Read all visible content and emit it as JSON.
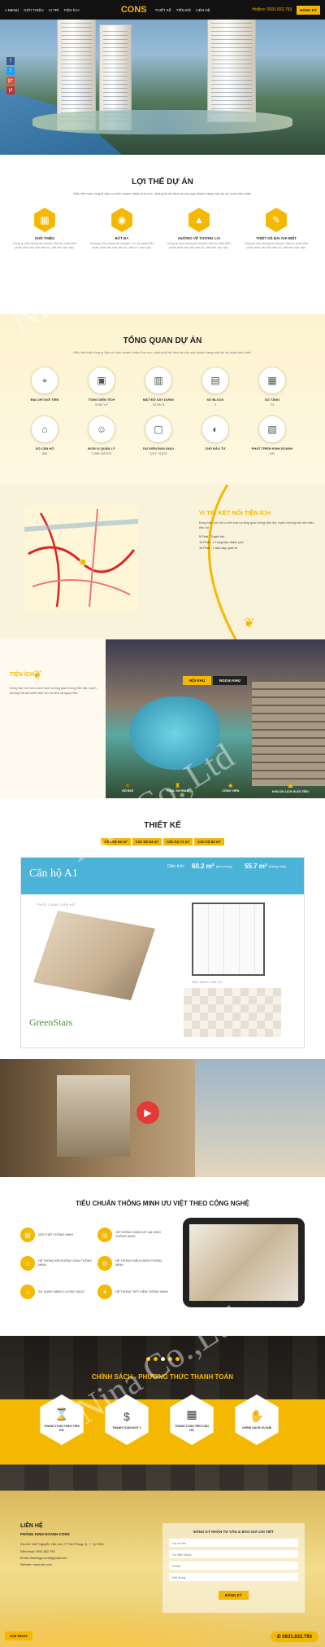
{
  "header": {
    "menu_label": "≡ MENU",
    "nav": [
      "GIỚI THIỆU",
      "VỊ TRÍ",
      "TIỆN ÍCH",
      "THIẾT KẾ",
      "TIẾN ĐỘ",
      "LIÊN HỆ"
    ],
    "logo": "CONS",
    "phone": "Hotline: 0931.832.793",
    "cta": "ĐĂNG KÝ"
  },
  "hero": {
    "social": [
      "f",
      "t",
      "g+",
      "yt"
    ]
  },
  "overview": {
    "title": "LỢI THẾ DỰ ÁN",
    "subtitle": "Hiểu thế mới công ty đầu cơ kinh doanh nhiều lĩnh vực, chúng tôi sẽ đem lại cho quý khách hàng một dự án hoàn hảo nhất.",
    "features": [
      {
        "title": "GIỚI THIỆU",
        "desc": "Công ty của chúng tôi chuyên đầu tư phát triển phân phối các loại căn hộ, đất nền cao cấp.",
        "icon": "building-icon"
      },
      {
        "title": "BẤT ĐÁ",
        "desc": "Công ty của chúng tôi chuyên đầu tư phát triển phân phối các loại căn hộ, đất nền cao cấp.",
        "icon": "location-icon"
      },
      {
        "title": "HƯỚNG VỀ TƯƠNG LAI",
        "desc": "Công ty của chúng tôi chuyên đầu tư phát triển phân phối các loại căn hộ, đất nền cao cấp.",
        "icon": "chart-icon"
      },
      {
        "title": "THIẾT KẾ ĐẠI CHI BIỆT",
        "desc": "Công ty của chúng tôi chuyên đầu tư phát triển phân phối các loại căn hộ, đất nền cao cấp.",
        "icon": "design-icon"
      }
    ]
  },
  "stats": {
    "title": "TỔNG QUAN DỰ ÁN",
    "subtitle": "Hiểu thế mới công ty đầu cơ kinh doanh nhiều lĩnh vực, chúng tôi sẽ đem lại cho quý khách hàng một dự án hoàn hảo nhất.",
    "items": [
      {
        "label": "ĐỊA CHỈ GIỚI TIẾN",
        "value": "",
        "icon": "pin-icon"
      },
      {
        "label": "TỔNG DIỆN TÍCH",
        "value": "9.987 m²",
        "icon": "area-icon"
      },
      {
        "label": "MẬT ĐỘ XÂY DỰNG",
        "value": "34.88 %",
        "icon": "density-icon"
      },
      {
        "label": "SỐ BLOCK",
        "value": "2",
        "icon": "block-icon"
      },
      {
        "label": "SỐ TẦNG",
        "value": "24",
        "icon": "floor-icon"
      },
      {
        "label": "SỐ CĂN HỘ",
        "value": "966",
        "icon": "apartment-icon"
      },
      {
        "label": "ĐƠN VỊ QUẢN LÝ",
        "value": "2.288 NGƯỜI",
        "icon": "people-icon"
      },
      {
        "label": "DỰ KIẾN BÀN GIAO",
        "value": "QUÝ I/2019",
        "icon": "handover-icon"
      },
      {
        "label": "CHỦ ĐẦU TƯ",
        "value": "",
        "icon": "investor-icon"
      },
      {
        "label": "PHÁT TRIỂN KINH DOANH",
        "value": "NĐ",
        "icon": "business-icon"
      }
    ]
  },
  "location": {
    "title": "VỊ TRÍ KẾT NỐI TIỆN ÍCH",
    "lines": [
      "Đồng Nai, nơi hội tụ tinh hoa hạ tầng giao thông hiện đại, tuyến đường trải dài nhiều tiện ích.",
      "5 Phút - Tuyến Hà...",
      "10 Phút - 1 Trung tâm thành phố",
      "15 Phút - 1 Sân bay quốc tế"
    ]
  },
  "amenity": {
    "title": "TIỆN ÍCH",
    "text": "Đồng Nai, nơi hội tụ tinh hoa hạ tầng giao thông hiện đại, tuyến đường trải dài nhiều tiện ích nội khu và ngoại khu.",
    "tabs": [
      "NỘI KHU",
      "NGOẠI KHU"
    ],
    "items": [
      "HỒ BƠI",
      "POOL SKYBAR",
      "CÔNG VIÊN",
      "KHU DU LỊCH SUỐI TIÊN"
    ]
  },
  "design": {
    "title": "THIẾT KẾ",
    "tabs": [
      "Căn hộ 62 m²",
      "Căn hộ 64 m²",
      "Căn hộ 71 m²",
      "Căn hộ 82 m²"
    ],
    "unit": "Căn hộ A1",
    "area_label": "Diện tích:",
    "area1": "60.2 m²",
    "area1_note": "(tim tường)",
    "area2": "55.7 m²",
    "area2_note": "(thông thủy)",
    "persp": "PHỐI CẢNH CĂN HỘ",
    "plan": "MẶT BẰNG CĂN HỘ",
    "brand": "GreenStars"
  },
  "tech": {
    "title": "TIÊU CHUẨN THÔNG MINH ƯU VIỆT THEO CÔNG NGHỆ",
    "items": [
      "NỘI THẤT THÔNG MINH",
      "HỆ THỐNG GIÁM SÁT AN NINH THÔNG MINH",
      "HỆ THỐNG ĐỂ KHÔNG GIAN THÔNG MINH",
      "HỆ THỐNG ĐIỀU KHIỂN THÔNG MINH",
      "SỬ DỤNG NĂNG LƯỢNG SẠCH",
      "HỆ THỐNG TIẾT KIỆM THÔNG MINH"
    ]
  },
  "payment": {
    "title": "CHÍNH SÁCH - PHƯƠNG THỨC THANH TOÁN",
    "items": [
      "THANH TOÁN THEO TIẾN ĐỘ",
      "THANH TOÁN ĐỢT 1",
      "THANH TOÁN TIỀN CĂN HỘ",
      "CHÍNH SÁCH ƯU ĐÃI"
    ]
  },
  "contact": {
    "title": "LIÊN HỆ",
    "company": "PHÒNG KINH DOANH CONS",
    "address": "Địa chỉ: 1567 Nguyễn Văn Linh, P. Tân Phong, Q. 7, Tp HCM",
    "phone": "Điện thoại: 0931.832.793",
    "email": "Email: thanhnga.cons@gmail.com",
    "web": "Website: www.abc.com",
    "form_title": "ĐĂNG KÝ NHẬN TƯ VẤN & BÁO GIÁ CHI TIẾT",
    "fields": [
      "Họ và tên",
      "Số điện thoại",
      "Email",
      "Nội dung"
    ],
    "submit": "ĐĂNG KÝ",
    "hotline": "0931.832.793",
    "footer_cta": "GỌI NGAY"
  },
  "watermark": "Nina Co.,Ltd",
  "colors": {
    "accent": "#f5b800",
    "dark": "#111111"
  }
}
